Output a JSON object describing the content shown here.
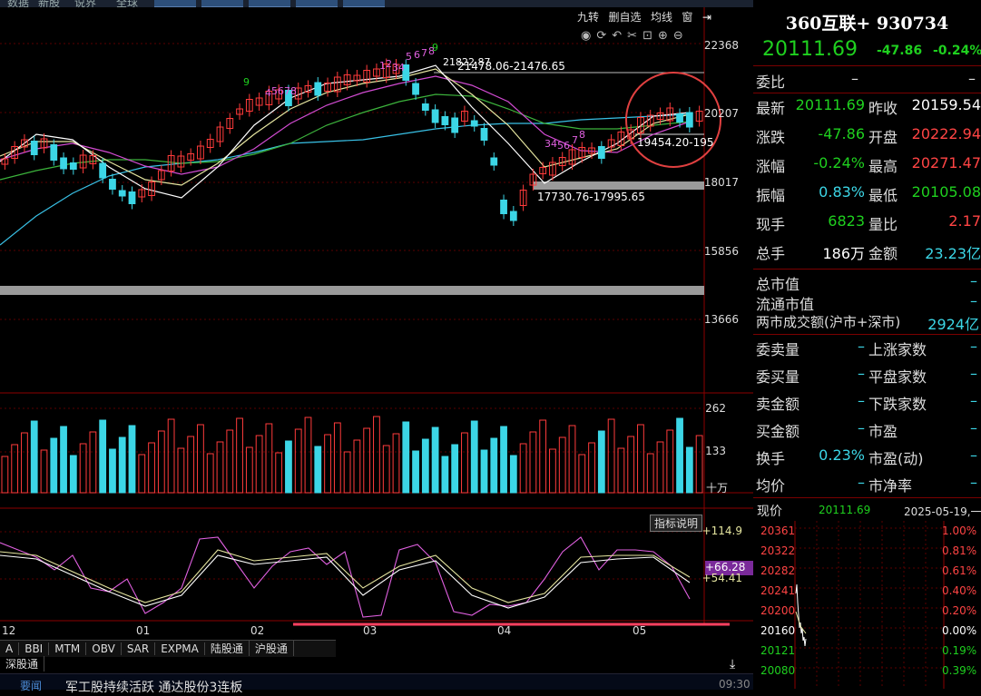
{
  "header": {
    "title": "360互联+ 930734",
    "price": "20111.69",
    "change": "-47.86",
    "change_pct": "-0.24%"
  },
  "top_menu": [
    "数据",
    "新股",
    "说界",
    "全球"
  ],
  "chart_toolbar": {
    "buttons": [
      "九转",
      "删自选",
      "均线",
      "窗"
    ]
  },
  "price_axis": [
    "22368",
    "20207",
    "18017",
    "15856",
    "13666"
  ],
  "volume_axis": [
    "262",
    "133",
    "十万"
  ],
  "indicator_axis": {
    "top": "+114.9",
    "current": "+66.28",
    "mid": "+54.41",
    "explain_button": "指标说明"
  },
  "annotations": {
    "high": "21822.87",
    "range1": "21478.06-21476.65",
    "range2": "17730.76-17995.65",
    "range3": "19454.20-195",
    "td_seq_top": [
      "1",
      "2",
      "34",
      "5",
      "6",
      "7",
      "8",
      "9"
    ],
    "td_seq_mid": [
      "4",
      "5",
      "6",
      "7",
      "8",
      "9"
    ],
    "td_seq_down": [
      "3",
      "4",
      "5",
      "6",
      "7",
      "8"
    ]
  },
  "x_axis": [
    "12",
    "01",
    "02",
    "03",
    "04",
    "05"
  ],
  "indicator_tabs": [
    "A",
    "BBI",
    "MTM",
    "OBV",
    "SAR",
    "EXPMA",
    "陆股通",
    "沪股通",
    "深股通"
  ],
  "news_ticker": {
    "prefix": "要闻",
    "text": "军工股持续活跃 通达股份3连板",
    "time": "09:30"
  },
  "quote": {
    "weibi_label": "委比",
    "weibi_value": "–",
    "weibi_value2": "–",
    "rows": [
      {
        "k1": "最新",
        "v1": "20111.69",
        "c1": "green",
        "k2": "昨收",
        "v2": "20159.54",
        "c2": "white"
      },
      {
        "k1": "涨跌",
        "v1": "-47.86",
        "c1": "green",
        "k2": "开盘",
        "v2": "20222.94",
        "c2": "red"
      },
      {
        "k1": "涨幅",
        "v1": "-0.24%",
        "c1": "green",
        "k2": "最高",
        "v2": "20271.47",
        "c2": "red"
      },
      {
        "k1": "振幅",
        "v1": "0.83%",
        "c1": "cyan",
        "k2": "最低",
        "v2": "20105.08",
        "c2": "green"
      },
      {
        "k1": "现手",
        "v1": "6823",
        "c1": "green",
        "k2": "量比",
        "v2": "2.17",
        "c2": "red"
      },
      {
        "k1": "总手",
        "v1": "186万",
        "c1": "white",
        "k2": "金额",
        "v2": "23.23亿",
        "c2": "cyan"
      }
    ],
    "mkt": [
      {
        "k": "总市值",
        "v": "–"
      },
      {
        "k": "流通市值",
        "v": "–"
      },
      {
        "k": "两市成交额(沪市+深市)",
        "v": "2924亿"
      }
    ],
    "stats": [
      {
        "k1": "委卖量",
        "v1": "–",
        "k2": "上涨家数",
        "v2": "–"
      },
      {
        "k1": "委买量",
        "v1": "–",
        "k2": "平盘家数",
        "v2": "–"
      },
      {
        "k1": "卖金额",
        "v1": "–",
        "k2": "下跌家数",
        "v2": "–"
      },
      {
        "k1": "买金额",
        "v1": "–",
        "k2": "市盈",
        "v2": "–"
      },
      {
        "k1": "换手",
        "v1": "0.23%",
        "k2": "市盈(动)",
        "v2": "–"
      },
      {
        "k1": "均价",
        "v1": "–",
        "k2": "市净率",
        "v2": "–"
      }
    ]
  },
  "intraday": {
    "label": "现价",
    "price": "20111.69",
    "date": "2025-05-19,一",
    "left_axis": [
      "20361",
      "20322",
      "20282",
      "20241",
      "20200",
      "20160",
      "20121",
      "20080"
    ],
    "right_axis": [
      "1.00%",
      "0.81%",
      "0.61%",
      "0.40%",
      "0.20%",
      "0.00%",
      "0.19%",
      "0.39%"
    ]
  },
  "colors": {
    "up": "#ff3b3b",
    "down": "#3cd6e6",
    "bg": "#000000",
    "grid": "#5a0000",
    "accent": "#1fd01f"
  }
}
